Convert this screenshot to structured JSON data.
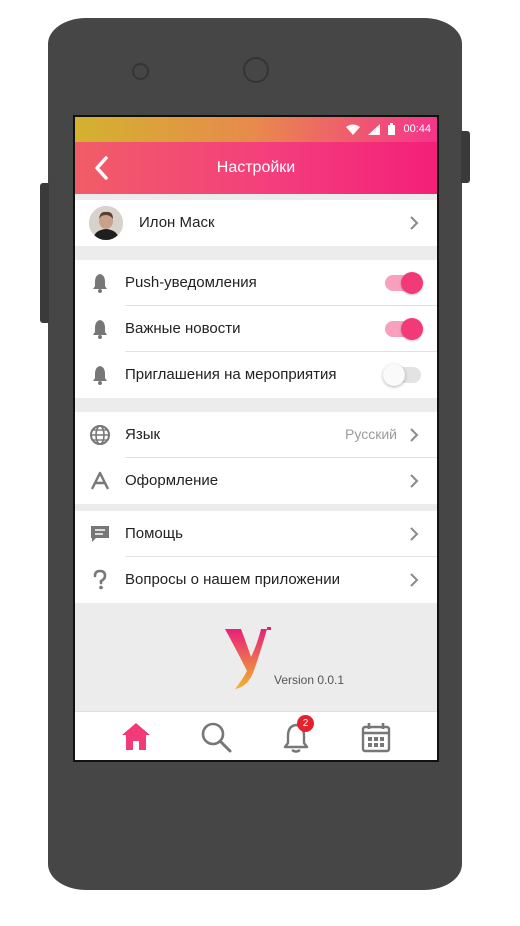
{
  "status_bar": {
    "time": "00:44"
  },
  "header": {
    "title": "Настройки"
  },
  "profile": {
    "name": "Илон Маск"
  },
  "notifications": {
    "items": [
      {
        "label": "Push-уведомления",
        "enabled": true
      },
      {
        "label": "Важные новости",
        "enabled": true
      },
      {
        "label": "Приглашения на мероприятия",
        "enabled": false
      }
    ]
  },
  "preferences": {
    "language": {
      "label": "Язык",
      "value": "Русский"
    },
    "appearance": {
      "label": "Оформление"
    }
  },
  "support": {
    "help": {
      "label": "Помощь"
    },
    "faq": {
      "label": "Вопросы о нашем приложении"
    }
  },
  "footer": {
    "version": "Version 0.0.1"
  },
  "bottom_nav": {
    "items": [
      "home-icon",
      "search-icon",
      "notifications-icon",
      "calendar-icon"
    ],
    "notification_badge": "2"
  },
  "colors": {
    "accent": "#f23a78",
    "appbar_start": "#f15d67",
    "appbar_end": "#f51f79",
    "statusbar_start": "#d4b22e"
  }
}
